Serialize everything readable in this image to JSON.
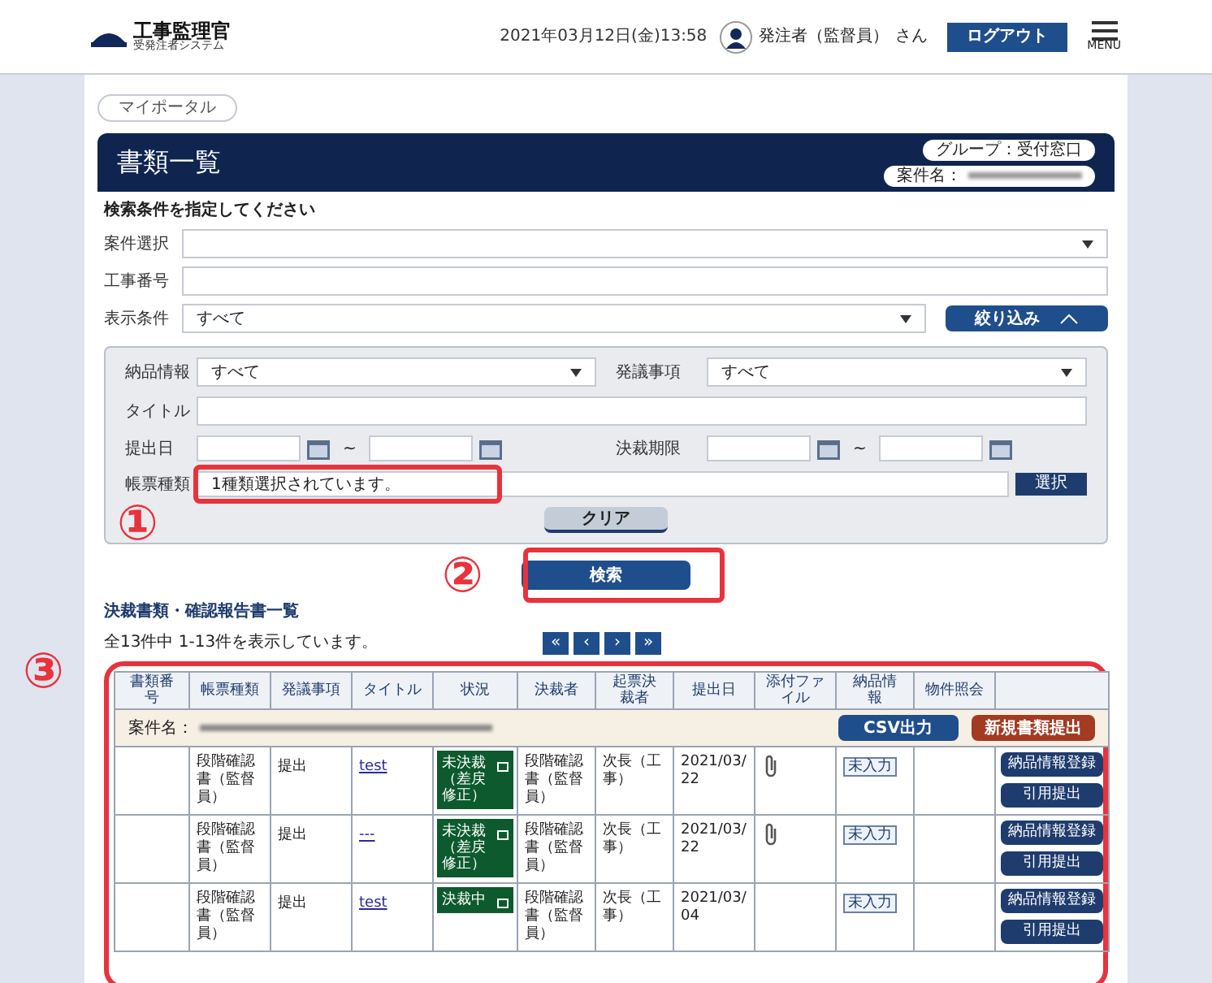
{
  "header": {
    "logo_title": "工事監理官",
    "logo_subtitle": "受発注者システム",
    "datetime": "2021年03月12日(金)13:58",
    "user_name": "発注者（監督員）",
    "user_suffix": "さん",
    "logout": "ログアウト",
    "menu": "MENU"
  },
  "breadcrumb": "マイポータル",
  "page": {
    "title": "書類一覧",
    "group_badge": "グループ：受付窓口",
    "project_badge": "案件名："
  },
  "search": {
    "instruction": "検索条件を指定してください",
    "fields": [
      {
        "label": "案件選択",
        "kind": "select"
      },
      {
        "label": "工事番号",
        "kind": "text"
      },
      {
        "label": "表示条件",
        "kind": "select",
        "value": "すべて"
      }
    ],
    "filter_toggle": {
      "label": "絞り込み",
      "expanded": true
    },
    "filter": {
      "delivery": {
        "label": "納品情報",
        "value": "すべて"
      },
      "proposal": {
        "label": "発議事項",
        "value": "すべて"
      },
      "title": {
        "label": "タイトル"
      },
      "submitted": {
        "label": "提出日",
        "separator": "~"
      },
      "deadline": {
        "label": "決裁期限",
        "separator": "~"
      },
      "form_type": {
        "label": "帳票種類",
        "value": "1種類選択されています。",
        "button": "選択"
      },
      "clear": "クリア"
    },
    "submit": "検索"
  },
  "annotations": [
    "①",
    "②",
    "③"
  ],
  "results": {
    "title": "決裁書類・確認報告書一覧",
    "count": "全13件中 1-13件を表示しています。",
    "pager": [
      "«",
      "‹",
      "›",
      "»"
    ],
    "columns": [
      "書類番号",
      "帳票種類",
      "発議事項",
      "タイトル",
      "状況",
      "決裁者",
      "起票決裁者",
      "提出日",
      "添付ファイル",
      "納品情報",
      "物件照会"
    ],
    "project_label": "案件名：",
    "csv": "CSV出力",
    "new_doc": "新規書類提出",
    "rows": [
      {
        "form_type": "段階確認書（監督員）",
        "proposal": "提出",
        "title": "test",
        "status": "未決裁（差戻修正）",
        "approver": "段階確認書（監督員）",
        "drafter": "次長（工事）",
        "date": "2021/03/22",
        "attachment": true,
        "delivery": "未入力",
        "actions": [
          "納品情報登録",
          "引用提出"
        ]
      },
      {
        "form_type": "段階確認書（監督員）",
        "proposal": "提出",
        "title": "---",
        "status": "未決裁（差戻修正）",
        "approver": "段階確認書（監督員）",
        "drafter": "次長（工事）",
        "date": "2021/03/22",
        "attachment": true,
        "delivery": "未入力",
        "actions": [
          "納品情報登録",
          "引用提出"
        ]
      },
      {
        "form_type": "段階確認書（監督員）",
        "proposal": "提出",
        "title": "test",
        "status": "決裁中",
        "approver": "段階確認書（監督員）",
        "drafter": "次長（工事）",
        "date": "2021/03/04",
        "attachment": false,
        "delivery": "未入力",
        "actions": [
          "納品情報登録",
          "引用提出"
        ]
      }
    ]
  }
}
